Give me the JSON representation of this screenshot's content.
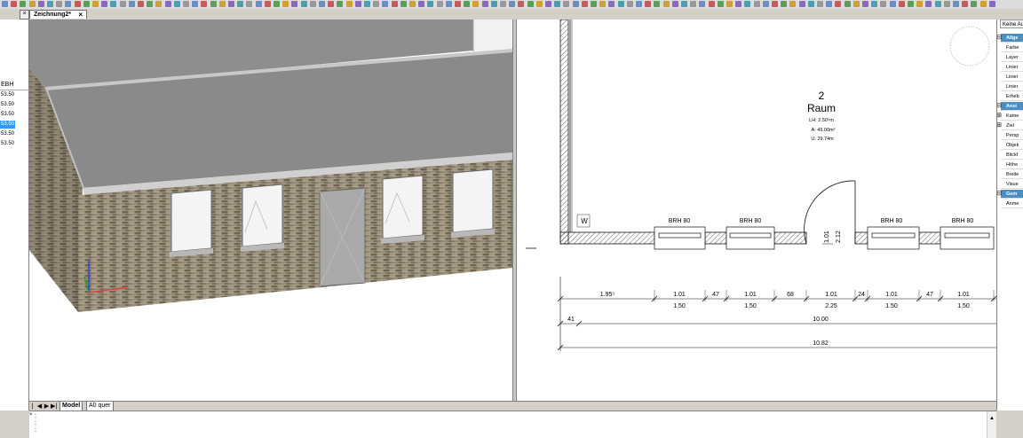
{
  "document_tab": {
    "title": "Zeichnung2*",
    "close": "×"
  },
  "left_panel": {
    "pin_close": "×",
    "header": "EBH",
    "rows": [
      "53.50",
      "53.50",
      "53.50",
      "53.50",
      "53.50",
      "53.50"
    ],
    "selected_index": 3
  },
  "right_panel": {
    "top_field": "Keine Au",
    "rows": [
      {
        "label": "Allge",
        "section": true,
        "exp": "⊟"
      },
      {
        "label": "Farbe",
        "section": false,
        "exp": ""
      },
      {
        "label": "Layer",
        "section": false,
        "exp": ""
      },
      {
        "label": "Linier",
        "section": false,
        "exp": ""
      },
      {
        "label": "Linier",
        "section": false,
        "exp": ""
      },
      {
        "label": "Linier",
        "section": false,
        "exp": ""
      },
      {
        "label": "Erheb",
        "section": false,
        "exp": ""
      },
      {
        "label": "Ansi",
        "section": true,
        "exp": "⊟"
      },
      {
        "label": "Kame",
        "section": false,
        "exp": "⊞"
      },
      {
        "label": "Ziel",
        "section": false,
        "exp": "⊞"
      },
      {
        "label": "Persp",
        "section": false,
        "exp": ""
      },
      {
        "label": "Objek",
        "section": false,
        "exp": ""
      },
      {
        "label": "Blickf",
        "section": false,
        "exp": ""
      },
      {
        "label": "Höhe",
        "section": false,
        "exp": ""
      },
      {
        "label": "Breite",
        "section": false,
        "exp": ""
      },
      {
        "label": "Visue",
        "section": false,
        "exp": ""
      },
      {
        "label": "Gem",
        "section": true,
        "exp": "⊟"
      },
      {
        "label": "Anme",
        "section": false,
        "exp": ""
      }
    ]
  },
  "layout_tabs": {
    "nav": [
      "|◀",
      "◀",
      "▶",
      "▶|"
    ],
    "tabs": [
      "Model",
      "A0 quer"
    ]
  },
  "command_line": {
    "lines": [
      ":",
      ":",
      ":"
    ],
    "close": "×",
    "scroll_up": "▲"
  },
  "plan": {
    "room_number": "2",
    "room_name": "Raum",
    "room_lh": "LH: 2.50⁵m",
    "room_area": "A: 49.00m²",
    "room_perimeter": "U: 29.74m",
    "wall_label": "W",
    "windows": [
      "BRH 80",
      "BRH 80",
      "BRH 80",
      "BRH 80"
    ],
    "door_width": "1.01",
    "door_height": "2.12",
    "dim_row1": [
      "1.95⁵",
      "1.01",
      "47",
      "1.01",
      "68",
      "1.01",
      "24",
      "1.01",
      "47",
      "1.01"
    ],
    "dim_row1_below": [
      "1.50",
      "1.50",
      "2.25",
      "1.50",
      "1.50"
    ],
    "dim_row2": [
      "41",
      "10.00"
    ],
    "dim_row3": [
      "10.82"
    ]
  },
  "colors": {
    "selection": "#3399ff",
    "section_header": "#4a8ec2",
    "roof": "#8c8c8c",
    "brick": "#8a7e68"
  }
}
